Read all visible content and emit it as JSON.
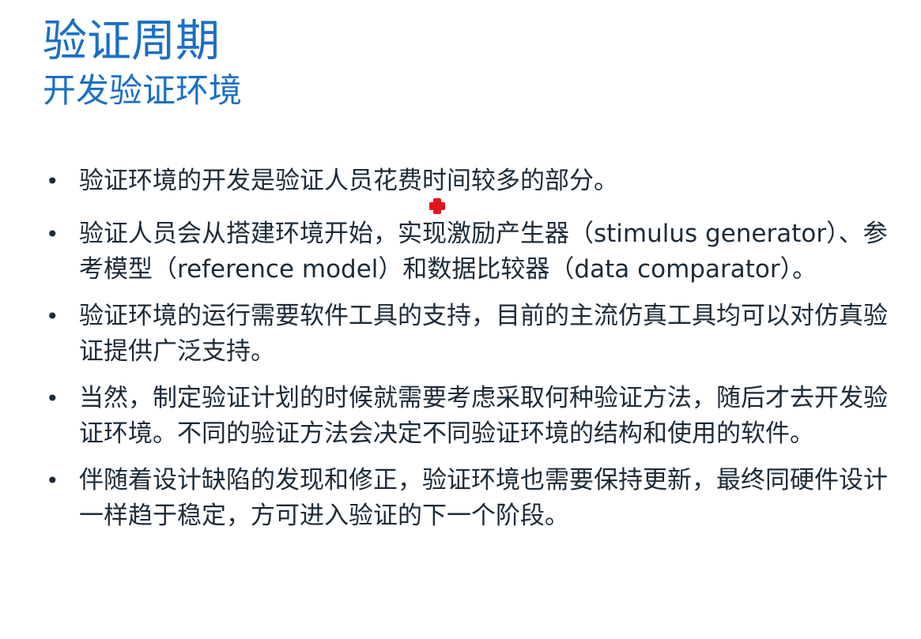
{
  "slide": {
    "title": "验证周期",
    "subtitle": "开发验证环境",
    "bullets": [
      "验证环境的开发是验证人员花费时间较多的部分。",
      "验证人员会从搭建环境开始，实现激励产生器（stimulus generator）、参考模型（reference model）和数据比较器（data comparator）。",
      "验证环境的运行需要软件工具的支持，目前的主流仿真工具均可以对仿真验证提供广泛支持。",
      "当然，制定验证计划的时候就需要考虑采取何种验证方法，随后才去开发验证环境。不同的验证方法会决定不同验证环境的结构和使用的软件。",
      "伴随着设计缺陷的发现和修正，验证环境也需要保持更新，最终同硬件设计一样趋于稳定，方可进入验证的下一个阶段。"
    ],
    "bullet_symbol": "•"
  },
  "colors": {
    "title": "#1a6fc4",
    "body_text": "#1c2b39",
    "pointer": "#e3151c"
  },
  "icons": {
    "pointer": "red-cross-pointer-icon"
  }
}
